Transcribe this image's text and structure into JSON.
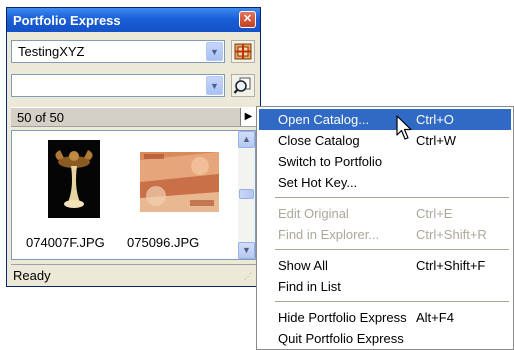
{
  "window": {
    "title": "Portfolio Express",
    "close_glyph": "✕"
  },
  "controls": {
    "catalog_combo_value": "TestingXYZ",
    "search_combo_value": "",
    "combo_arrow_glyph": "▼"
  },
  "count_bar": {
    "text": "50 of 50",
    "menu_glyph": "▶"
  },
  "thumbnails": [
    {
      "filename": "074007F.JPG"
    },
    {
      "filename": "075096.JPG"
    }
  ],
  "scrollbar": {
    "up_glyph": "▲",
    "down_glyph": "▼"
  },
  "status": {
    "text": "Ready"
  },
  "menu": {
    "items": [
      {
        "label": "Open Catalog...",
        "shortcut": "Ctrl+O"
      },
      {
        "label": "Close Catalog",
        "shortcut": "Ctrl+W"
      },
      {
        "label": "Switch to Portfolio",
        "shortcut": ""
      },
      {
        "label": "Set Hot Key...",
        "shortcut": ""
      },
      {
        "label": "Edit Original",
        "shortcut": "Ctrl+E"
      },
      {
        "label": "Find in Explorer...",
        "shortcut": "Ctrl+Shift+R"
      },
      {
        "label": "Show All",
        "shortcut": "Ctrl+Shift+F"
      },
      {
        "label": "Find in List",
        "shortcut": ""
      },
      {
        "label": "Hide Portfolio Express",
        "shortcut": "Alt+F4"
      },
      {
        "label": "Quit Portfolio Express",
        "shortcut": ""
      }
    ]
  },
  "colors": {
    "titlebar": "#1a5fd8",
    "highlight": "#316ac5",
    "disabled_text": "#aca899"
  }
}
